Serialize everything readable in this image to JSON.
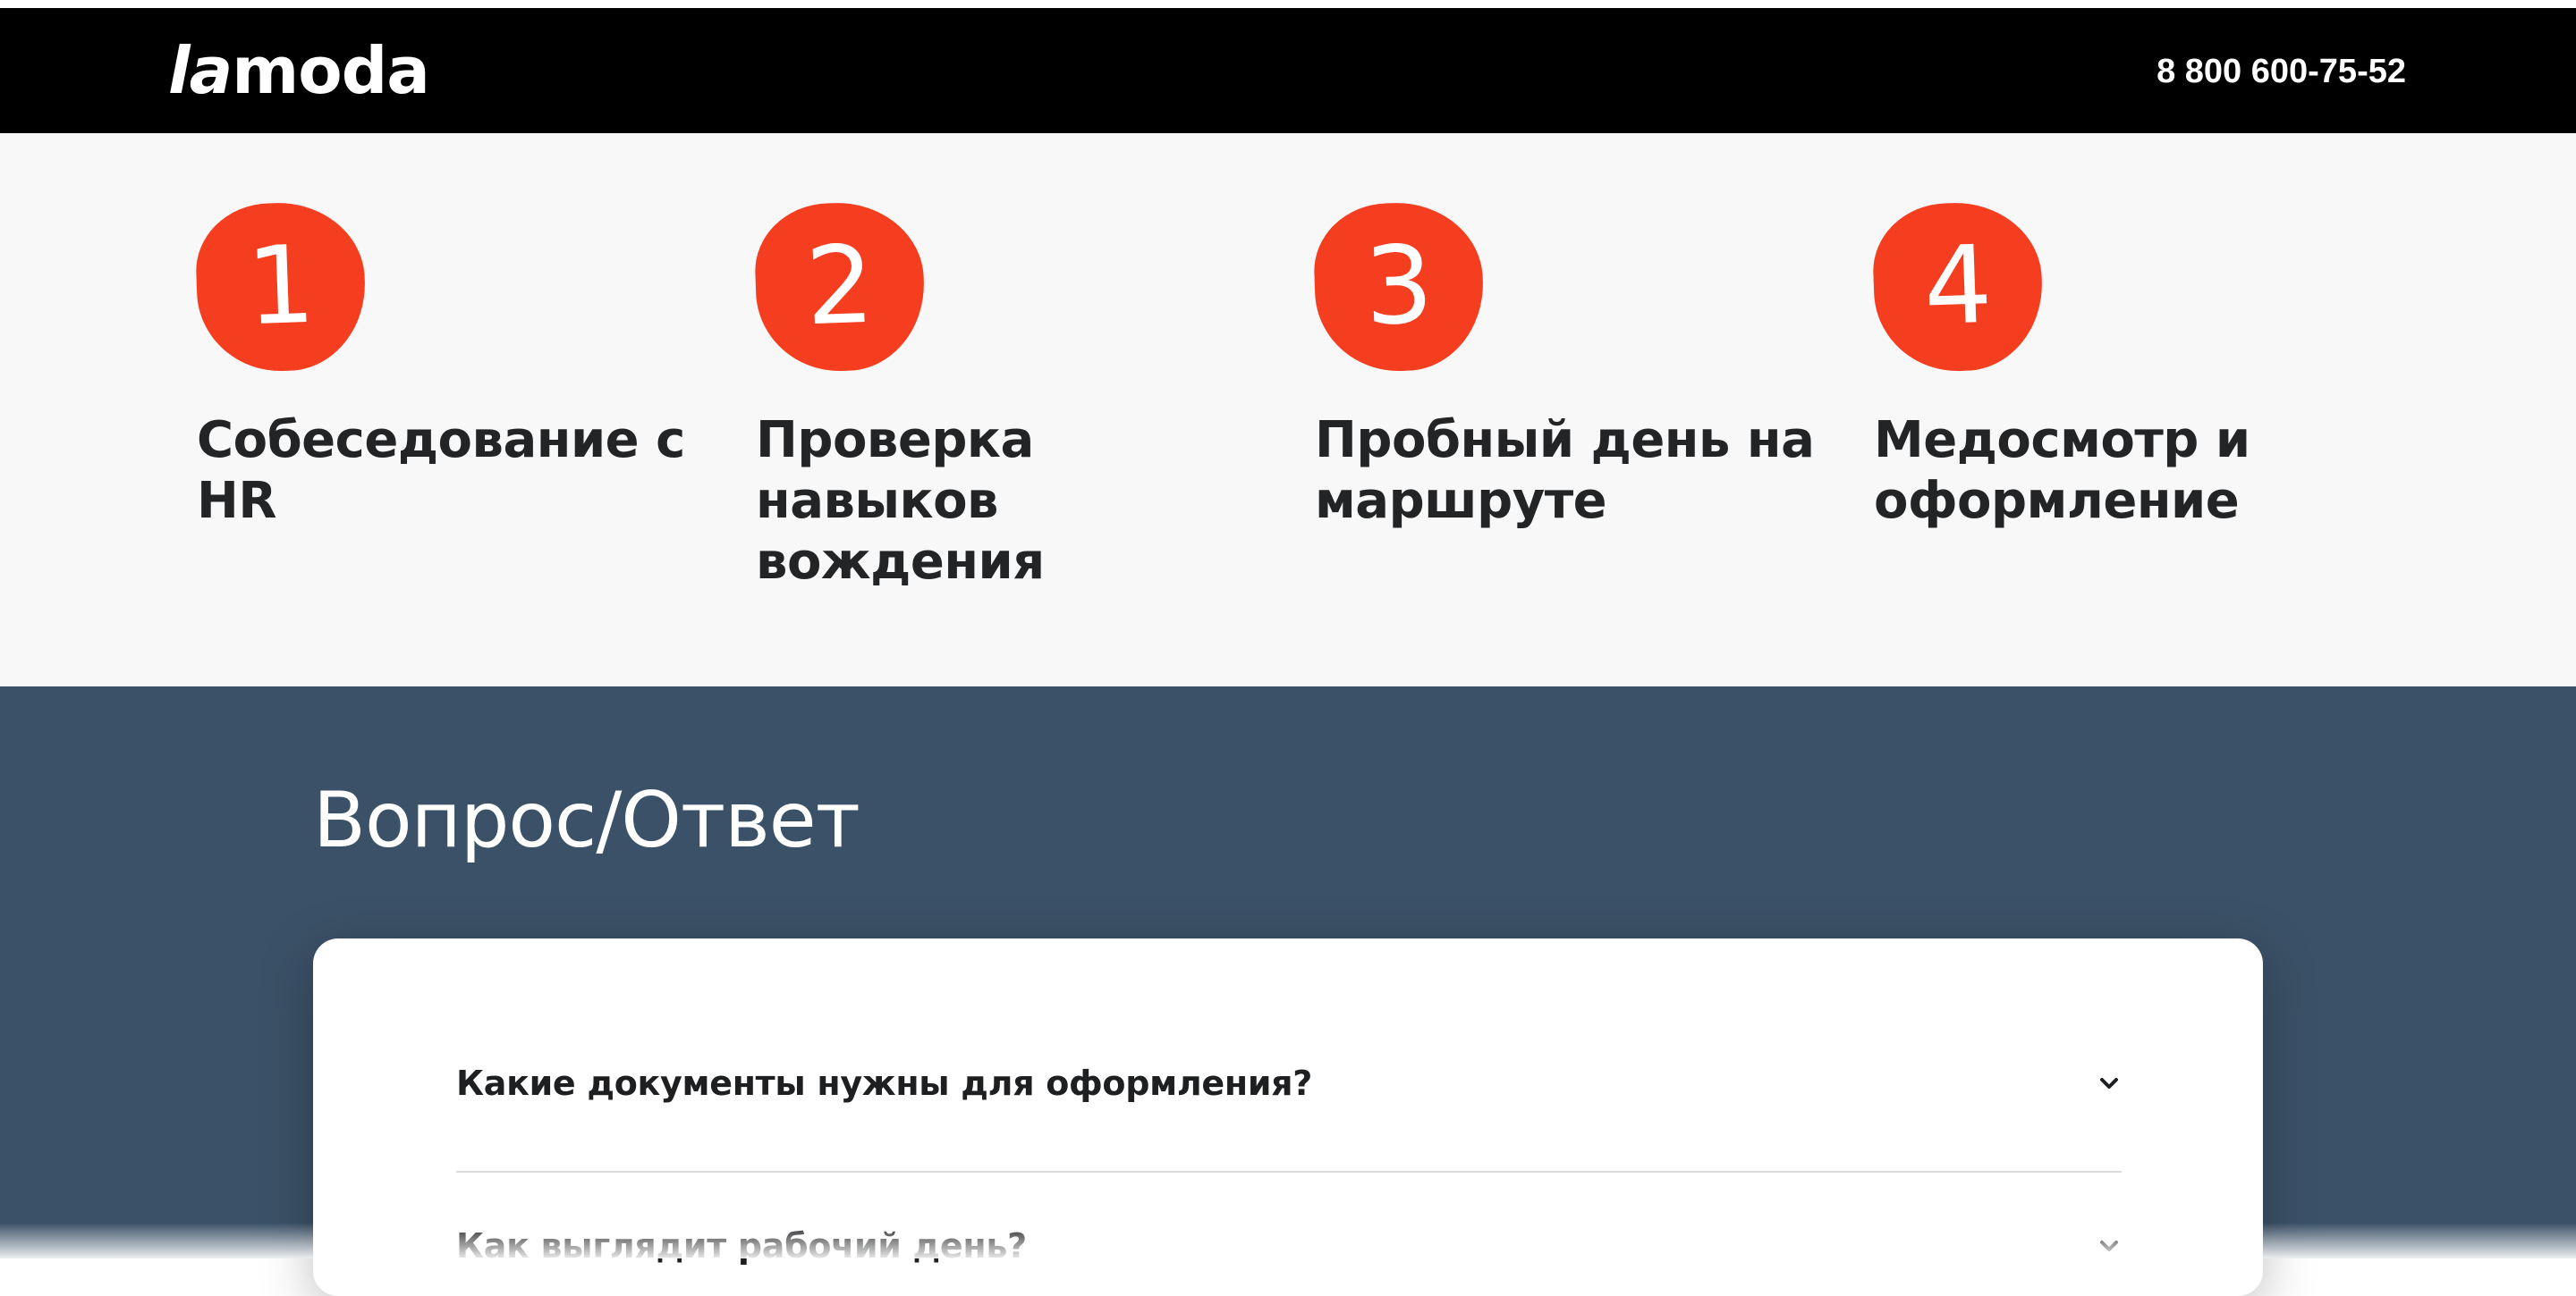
{
  "header": {
    "logo_la": "la",
    "logo_moda": "moda",
    "phone": "8 800 600-75-52"
  },
  "steps": [
    {
      "number": "1",
      "title": "Собеседование с HR"
    },
    {
      "number": "2",
      "title": "Проверка навыков вождения"
    },
    {
      "number": "3",
      "title": "Пробный день на маршруте"
    },
    {
      "number": "4",
      "title": "Медосмотр и оформление"
    }
  ],
  "faq": {
    "title": "Вопрос/Ответ",
    "items": [
      {
        "question": "Какие документы нужны для оформления?",
        "icon": "chevron-down-icon"
      },
      {
        "question": "Как выглядит рабочий день?",
        "icon": "chevron-down-icon"
      }
    ]
  },
  "colors": {
    "header_bg": "#000000",
    "accent": "#f53e20",
    "faq_bg": "#3b5167",
    "steps_bg": "#f8f8f8"
  }
}
